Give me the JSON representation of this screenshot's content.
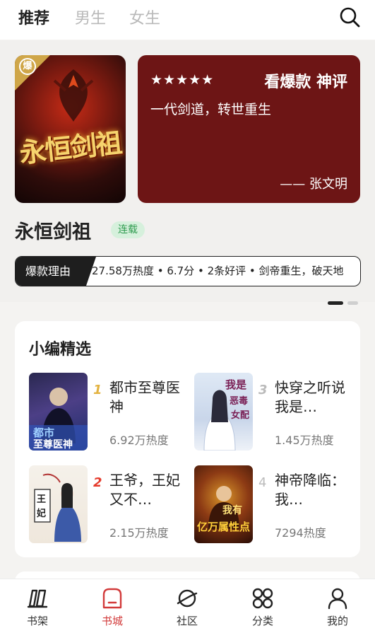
{
  "top_tabs": [
    {
      "label": "推荐",
      "active": true
    },
    {
      "label": "男生",
      "active": false
    },
    {
      "label": "女生",
      "active": false
    }
  ],
  "hero": {
    "ribbon_badge": "爆",
    "cover_art_text": "永恒剑祖",
    "stars": "★★★★★",
    "quote_title": "看爆款 神评",
    "quote_text": "一代剑道，转世重生",
    "quote_author": "—— 张文明",
    "book_title": "永恒剑祖",
    "status": "连载",
    "reason_label": "爆款理由",
    "reason_text": "27.58万热度 • 6.7分 • 2条好评 • 剑帝重生，破天地",
    "carousel_active": 1,
    "carousel_total": 2
  },
  "picks": {
    "title": "小编精选",
    "items": [
      {
        "rank": "1",
        "title": "都市至尊医神",
        "heat": "6.92万热度",
        "cover_text": "都市至尊医神"
      },
      {
        "rank": "3",
        "title": "快穿之听说我是…",
        "heat": "1.45万热度",
        "cover_text": "我是恶毒女配"
      },
      {
        "rank": "2",
        "title": "王爷，王妃又不…",
        "heat": "2.15万热度",
        "cover_text": "王妃"
      },
      {
        "rank": "4",
        "title": "神帝降临：我…",
        "heat": "7294热度",
        "cover_text": "亿万属性点"
      }
    ]
  },
  "bottom_nav": [
    {
      "label": "书架",
      "icon": "bookshelf-icon",
      "active": false
    },
    {
      "label": "书城",
      "icon": "bookstore-icon",
      "active": true
    },
    {
      "label": "社区",
      "icon": "community-planet-icon",
      "active": false
    },
    {
      "label": "分类",
      "icon": "category-grid-icon",
      "active": false
    },
    {
      "label": "我的",
      "icon": "profile-icon",
      "active": false
    }
  ],
  "colors": {
    "accent_red": "#d23a3a",
    "quote_card_bg": "#6d1515",
    "status_green": "#2f9b4f",
    "rank_gold": "#e3b341",
    "rank_red": "#e53b2c",
    "rank_gray": "#bbbbbb"
  }
}
